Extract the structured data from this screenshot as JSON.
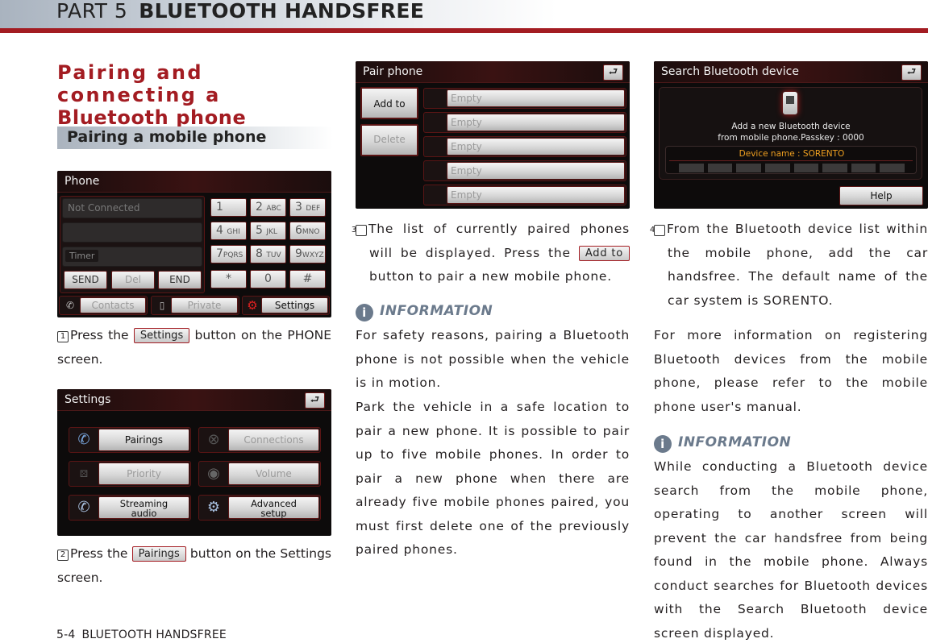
{
  "header": {
    "part_label": "PART 5",
    "part_name": "BLUETOOTH HANDSFREE"
  },
  "section": {
    "title_line1": "Pairing and connecting a",
    "title_line2": "Bluetooth phone",
    "subtitle": "Pairing a mobile phone"
  },
  "phone_screen": {
    "title": "Phone",
    "status_field": "Not Connected",
    "number_field": "",
    "timer_label": "Timer",
    "actions": [
      "SEND",
      "Del",
      "END"
    ],
    "keypad": [
      {
        "digit": "1",
        "letters": ""
      },
      {
        "digit": "2",
        "letters": "ABC"
      },
      {
        "digit": "3",
        "letters": "DEF"
      },
      {
        "digit": "4",
        "letters": "GHI"
      },
      {
        "digit": "5",
        "letters": "JKL"
      },
      {
        "digit": "6",
        "letters": "MNO"
      },
      {
        "digit": "7",
        "letters": "PQRS"
      },
      {
        "digit": "8",
        "letters": "TUV"
      },
      {
        "digit": "9",
        "letters": "WXYZ"
      },
      {
        "digit": "*",
        "letters": ""
      },
      {
        "digit": "0",
        "letters": ""
      },
      {
        "digit": "#",
        "letters": ""
      }
    ],
    "bottom_buttons": [
      "Contacts",
      "Private",
      "Settings"
    ]
  },
  "step1": {
    "number": "1",
    "before": "Press the ",
    "button": "Settings",
    "after": " button on the PHONE screen."
  },
  "settings_screen": {
    "title": "Settings",
    "back_icon": "back-arrow-icon",
    "buttons": [
      {
        "label": "Pairings",
        "icon": "phone-pairing-icon",
        "enabled": true
      },
      {
        "label": "Connections",
        "icon": "connections-icon",
        "enabled": false
      },
      {
        "label": "Priority",
        "icon": "priority-dice-icon",
        "enabled": false
      },
      {
        "label": "Volume",
        "icon": "volume-speaker-icon",
        "enabled": false
      },
      {
        "label": "Streaming audio",
        "icon": "streaming-audio-icon",
        "enabled": true
      },
      {
        "label": "Advanced setup",
        "icon": "advanced-setup-icon",
        "enabled": true
      }
    ]
  },
  "step2": {
    "number": "2",
    "before": "Press the ",
    "button": "Pairings",
    "after": "  button on the Settings screen."
  },
  "pair_screen": {
    "title": "Pair phone",
    "add_label": "Add to",
    "delete_label": "Delete",
    "slots": [
      "Empty",
      "Empty",
      "Empty",
      "Empty",
      "Empty"
    ]
  },
  "step3": {
    "number": "3",
    "before": "The list of currently paired phones will be displayed.  Press the ",
    "button": "Add to",
    "after": " button to pair a new mobile phone."
  },
  "info1": {
    "heading": "INFORMATION",
    "para1": "For safety reasons, pairing a Bluetooth phone is not possible when the vehicle is in motion.",
    "para2": "Park the vehicle in a safe location to pair a new phone. It is possible to pair up to five mobile phones.  In order to pair a new phone when there are already five mobile phones paired, you must first delete one of the previously paired phones."
  },
  "search_screen": {
    "title": "Search Bluetooth device",
    "message_line1": "Add a new Bluetooth device",
    "message_line2": "from mobile phone.Passkey : 0000",
    "device_name": "Device name : SORENTO",
    "progress_segments_total": 8,
    "progress_segments_filled": 0,
    "help_label": "Help",
    "accent_color": "#f0a020"
  },
  "step4": {
    "number": "4",
    "text": "From the Bluetooth device list within the mobile phone, add the car handsfree. The default name of the car system is SORENTO."
  },
  "more_info": "For more information on registering Bluetooth devices from the mobile phone, please refer to the mobile phone user's manual.",
  "info2": {
    "heading": "INFORMATION",
    "text": "While conducting a Bluetooth device search from the mobile phone, operating to another screen will prevent the car handsfree from being found in the mobile phone. Always conduct searches for Bluetooth devices with the Search Bluetooth device screen displayed."
  },
  "footer": {
    "page": "5-4",
    "section": "BLUETOOTH HANDSFREE"
  },
  "colors": {
    "brand_red": "#a31c22",
    "info_gray": "#6b7a8c"
  }
}
